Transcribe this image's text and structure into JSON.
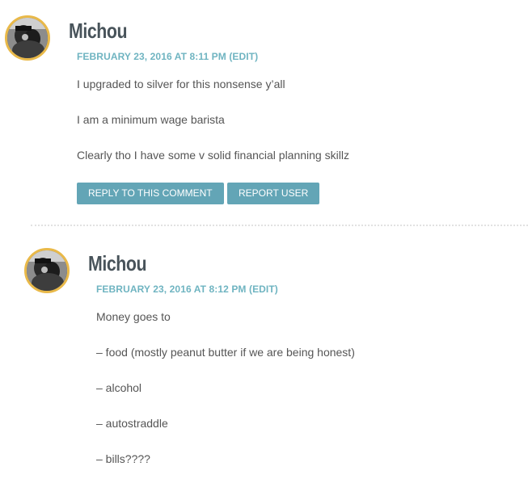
{
  "comments": [
    {
      "author": "Michou",
      "date": "FEBRUARY 23, 2016 AT 8:11 PM",
      "edit_label": "(EDIT)",
      "paragraphs": [
        "I upgraded to silver for this nonsense y’all",
        "I am a minimum wage barista",
        "Clearly tho I have some v solid financial planning skillz"
      ],
      "reply_label": "REPLY TO THIS COMMENT",
      "report_label": "REPORT USER"
    },
    {
      "author": "Michou",
      "date": "FEBRUARY 23, 2016 AT 8:12 PM",
      "edit_label": "(EDIT)",
      "paragraphs": [
        "Money goes to",
        "– food (mostly peanut butter if we are being honest)",
        "– alcohol",
        "– autostraddle",
        "– bills????"
      ]
    }
  ],
  "colors": {
    "avatar_ring": "#e9b949",
    "meta_link": "#6fb4c1",
    "button_bg": "#63a5b6",
    "author_text": "#48535a"
  },
  "icons": {
    "avatar": "user-avatar-photo"
  }
}
